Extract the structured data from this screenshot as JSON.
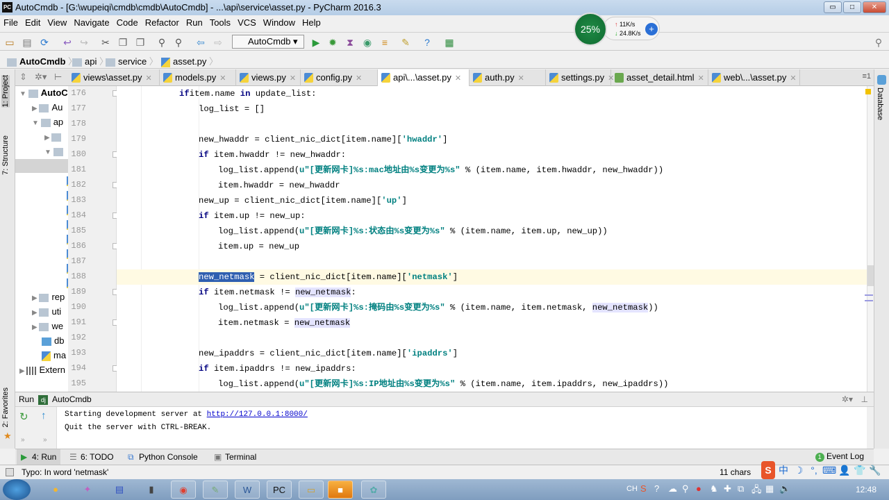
{
  "window": {
    "title": "AutoCmdb - [G:\\wupeiqi\\cmdb\\cmdb\\AutoCmdb] - ...\\api\\service\\asset.py - PyCharm 2016.3",
    "app_icon": "PC",
    "minimize": "▭",
    "maximize": "□",
    "close": "✕"
  },
  "menu": [
    "File",
    "Edit",
    "View",
    "Navigate",
    "Code",
    "Refactor",
    "Run",
    "Tools",
    "VCS",
    "Window",
    "Help"
  ],
  "toolbar": {
    "run_config": "AutoCmdb",
    "icons": [
      "open-icon",
      "save-icon",
      "sync-icon",
      "undo-icon",
      "redo-icon",
      "cut-icon",
      "copy-icon",
      "paste-icon",
      "find-icon",
      "replace-icon",
      "back-icon",
      "forward-icon",
      "run-icon",
      "debug-icon",
      "coverage-icon",
      "profile-icon",
      "concurrency-icon",
      "settings-icon",
      "help-icon",
      "vcs-icon",
      "search-icon"
    ]
  },
  "netmonitor": {
    "cpu": "25%",
    "upload": "11K/s",
    "download": "24.8K/s"
  },
  "breadcrumb": [
    "AutoCmdb",
    "api",
    "service",
    "asset.py"
  ],
  "tabs": [
    {
      "label": "views\\asset.py"
    },
    {
      "label": "models.py"
    },
    {
      "label": "views.py"
    },
    {
      "label": "config.py"
    },
    {
      "label": "api\\...\\asset.py",
      "active": true
    },
    {
      "label": "auth.py"
    },
    {
      "label": "settings.py"
    },
    {
      "label": "asset_detail.html",
      "type": "html"
    },
    {
      "label": "web\\...\\asset.py"
    }
  ],
  "tabs_overflow": "≡1",
  "left_strip": {
    "project": "1: Project",
    "structure": "7: Structure",
    "favorites": "2: Favorites"
  },
  "right_strip": {
    "database": "Database"
  },
  "project_tree": [
    {
      "label": "AutoC",
      "bold": true,
      "depth": 0,
      "arrow": "▼"
    },
    {
      "label": "Au",
      "depth": 1,
      "arrow": "▶"
    },
    {
      "label": "ap",
      "depth": 1,
      "arrow": "▼"
    },
    {
      "label": "",
      "depth": 2,
      "arrow": "▶"
    },
    {
      "label": "",
      "depth": 2,
      "arrow": "▼"
    },
    {
      "label": "",
      "depth": 3,
      "selected": true
    },
    {
      "label": "",
      "depth": 3,
      "file": true
    },
    {
      "label": "",
      "depth": 3,
      "file": true
    },
    {
      "label": "",
      "depth": 3,
      "file": true
    },
    {
      "label": "",
      "depth": 3,
      "file": true
    },
    {
      "label": "",
      "depth": 3,
      "file": true
    },
    {
      "label": "",
      "depth": 3,
      "file": true
    },
    {
      "label": "",
      "depth": 3,
      "file": true
    },
    {
      "label": "",
      "depth": 3,
      "file": true
    },
    {
      "label": "rep",
      "depth": 1,
      "arrow": "▶"
    },
    {
      "label": "uti",
      "depth": 1,
      "arrow": "▶"
    },
    {
      "label": "we",
      "depth": 1,
      "arrow": "▶"
    },
    {
      "label": "db",
      "depth": 1,
      "db": true
    },
    {
      "label": "ma",
      "depth": 1,
      "file": true
    },
    {
      "label": "Extern",
      "depth": 0,
      "arrow": "▶",
      "lib": true
    }
  ],
  "code": [
    {
      "n": "176",
      "indent": 0,
      "fold": true,
      "seg": [
        [
          "k",
          "if"
        ],
        [
          "",
          "item.name "
        ],
        [
          "k",
          "in"
        ],
        [
          "",
          " update_list:"
        ]
      ]
    },
    {
      "n": "177",
      "indent": 1,
      "seg": [
        [
          "",
          "log_list = []"
        ]
      ]
    },
    {
      "n": "178",
      "indent": 1,
      "seg": []
    },
    {
      "n": "179",
      "indent": 1,
      "seg": [
        [
          "",
          "new_hwaddr = client_nic_dict[item.name]["
        ],
        [
          "s",
          "'hwaddr'"
        ],
        [
          "",
          "]"
        ]
      ]
    },
    {
      "n": "180",
      "indent": 1,
      "fold": true,
      "seg": [
        [
          "k",
          "if"
        ],
        [
          "",
          " item.hwaddr != new_hwaddr:"
        ]
      ]
    },
    {
      "n": "181",
      "indent": 2,
      "seg": [
        [
          "",
          "log_list.append("
        ],
        [
          "s",
          "u\"[更新网卡]%s:mac地址由%s变更为%s\""
        ],
        [
          "",
          " % (item.name, item.hwaddr, new_hwaddr))"
        ]
      ]
    },
    {
      "n": "182",
      "indent": 2,
      "fold": true,
      "seg": [
        [
          "",
          "item.hwaddr = new_hwaddr"
        ]
      ]
    },
    {
      "n": "183",
      "indent": 1,
      "seg": [
        [
          "",
          "new_up = client_nic_dict[item.name]["
        ],
        [
          "s",
          "'up'"
        ],
        [
          "",
          "]"
        ]
      ]
    },
    {
      "n": "184",
      "indent": 1,
      "fold": true,
      "seg": [
        [
          "k",
          "if"
        ],
        [
          "",
          " item.up != new_up:"
        ]
      ]
    },
    {
      "n": "185",
      "indent": 2,
      "seg": [
        [
          "",
          "log_list.append("
        ],
        [
          "s",
          "u\"[更新网卡]%s:状态由%s变更为%s\""
        ],
        [
          "",
          " % (item.name, item.up, new_up))"
        ]
      ]
    },
    {
      "n": "186",
      "indent": 2,
      "fold": true,
      "seg": [
        [
          "",
          "item.up = new_up"
        ]
      ]
    },
    {
      "n": "187",
      "indent": 1,
      "seg": []
    },
    {
      "n": "188",
      "indent": 1,
      "current": true,
      "bulb": true,
      "seg": [
        [
          "sel",
          "new_netmask"
        ],
        [
          "",
          " = client_nic_dict[item.name]["
        ],
        [
          "s",
          "'netmask'"
        ],
        [
          "",
          "]"
        ]
      ]
    },
    {
      "n": "189",
      "indent": 1,
      "fold": true,
      "seg": [
        [
          "k",
          "if"
        ],
        [
          "",
          " item.netmask != "
        ],
        [
          "h",
          "new_netmask"
        ],
        [
          "",
          ":"
        ]
      ]
    },
    {
      "n": "190",
      "indent": 2,
      "seg": [
        [
          "",
          "log_list.append("
        ],
        [
          "s",
          "u\"[更新网卡]%s:掩码由%s变更为%s\""
        ],
        [
          "",
          " % (item.name, item.netmask, "
        ],
        [
          "h",
          "new_netmask"
        ],
        [
          "",
          "))"
        ]
      ]
    },
    {
      "n": "191",
      "indent": 2,
      "fold": true,
      "seg": [
        [
          "",
          "item.netmask = "
        ],
        [
          "h",
          "new_netmask"
        ]
      ]
    },
    {
      "n": "192",
      "indent": 1,
      "seg": []
    },
    {
      "n": "193",
      "indent": 1,
      "seg": [
        [
          "",
          "new_ipaddrs = client_nic_dict[item.name]["
        ],
        [
          "s",
          "'ipaddrs'"
        ],
        [
          "",
          "]"
        ]
      ]
    },
    {
      "n": "194",
      "indent": 1,
      "fold": true,
      "seg": [
        [
          "k",
          "if"
        ],
        [
          "",
          " item.ipaddrs != new_ipaddrs:"
        ]
      ]
    },
    {
      "n": "195",
      "indent": 2,
      "seg": [
        [
          "",
          "log_list.append("
        ],
        [
          "s",
          "u\"[更新网卡]%s:IP地址由%s变更为%s\""
        ],
        [
          "",
          " % (item.name, item.ipaddrs, new_ipaddrs))"
        ]
      ]
    }
  ],
  "run": {
    "header_label": "Run",
    "config": "AutoCmdb",
    "console": {
      "line1": "Starting development server at ",
      "link": "http://127.0.0.1:8000/",
      "line2": "Quit the server with CTRL-BREAK."
    }
  },
  "tool_tabs": [
    {
      "label": "4: Run",
      "active": true
    },
    {
      "label": "6: TODO"
    },
    {
      "label": "Python Console"
    },
    {
      "label": "Terminal"
    }
  ],
  "event_log": {
    "count": "1",
    "label": "Event Log"
  },
  "status": {
    "message": "Typo: In word 'netmask'",
    "chars": "11 chars",
    "ime": [
      "S",
      "中",
      "☽",
      "°,",
      "⌨",
      "👤",
      "👕",
      "🔧"
    ]
  },
  "taskbar": {
    "tray_lang": "CH",
    "clock": "12:48"
  }
}
